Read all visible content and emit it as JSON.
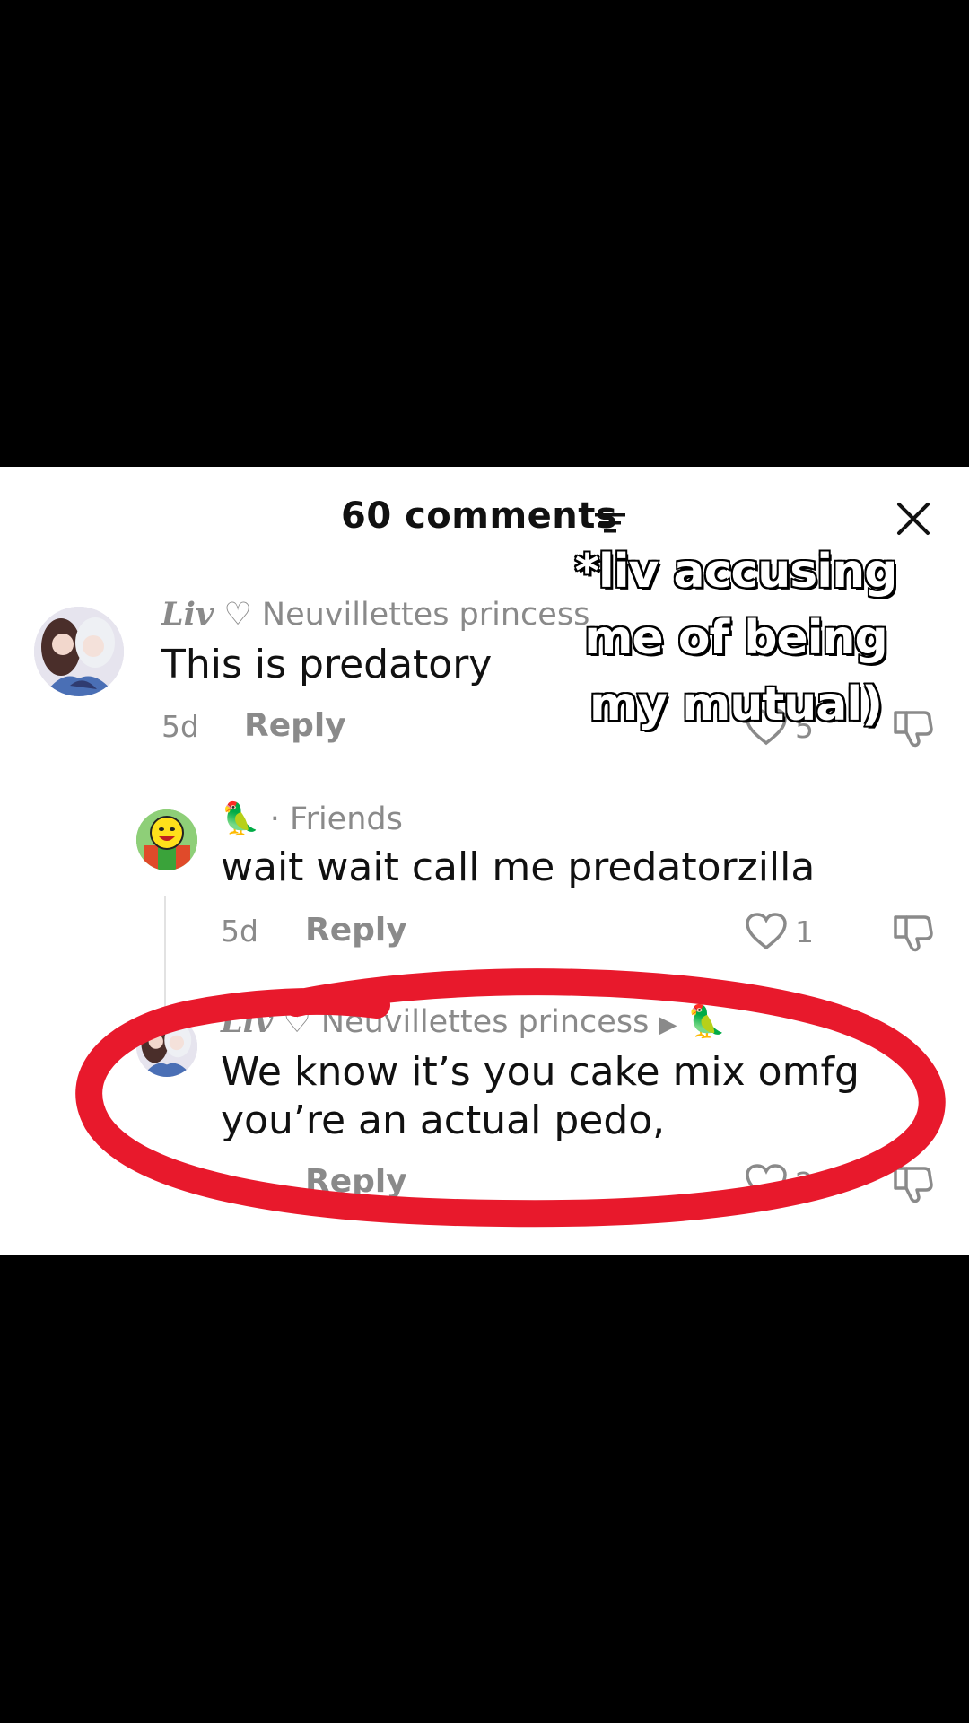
{
  "header": {
    "title": "60 comments"
  },
  "overlay": {
    "caption": "*liv accusing me of being my mutual)"
  },
  "comments": [
    {
      "username_styled": "Liv",
      "username_rest": "♡ Neuvillettes princess",
      "text": "This is predatory",
      "time": "5d",
      "reply_label": "Reply",
      "likes": "5"
    },
    {
      "username_emoji": "🦜",
      "username_rest": "· Friends",
      "text": "wait wait call me predatorzilla",
      "time": "5d",
      "reply_label": "Reply",
      "likes": "1"
    },
    {
      "username_styled": "Liv",
      "username_rest": "♡ Neuvillettes princess",
      "reply_to_emoji": "🦜",
      "text_line1": "We know it’s you cake mix omfg",
      "text_line2": "you’re an actual pedo,",
      "reply_label": "Reply",
      "likes": "2"
    }
  ],
  "colors": {
    "annotation_red": "#e8192c",
    "muted": "#8a8a8a"
  }
}
